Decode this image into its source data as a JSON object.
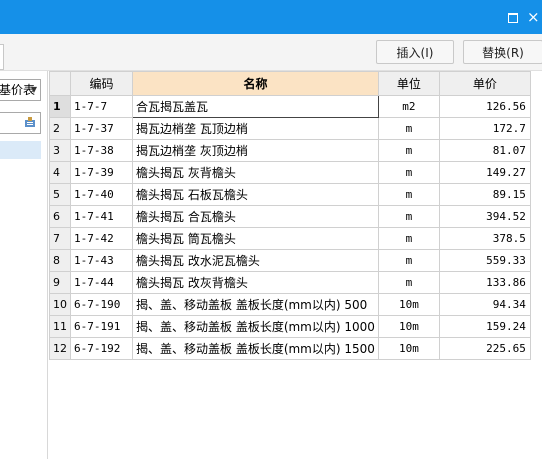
{
  "toolbar": {
    "insert_label": "插入(I)",
    "replace_label": "替换(R)"
  },
  "left": {
    "combo_value": "基价表"
  },
  "columns": {
    "code": "编码",
    "name": "名称",
    "unit": "单位",
    "price": "单价"
  },
  "rows": [
    {
      "num": "1",
      "code": "1-7-7",
      "name": "合瓦揭瓦盖瓦",
      "unit": "m2",
      "price": "126.56"
    },
    {
      "num": "2",
      "code": "1-7-37",
      "name": "揭瓦边梢垄 瓦顶边梢",
      "unit": "m",
      "price": "172.7"
    },
    {
      "num": "3",
      "code": "1-7-38",
      "name": "揭瓦边梢垄 灰顶边梢",
      "unit": "m",
      "price": "81.07"
    },
    {
      "num": "4",
      "code": "1-7-39",
      "name": "檐头揭瓦 灰背檐头",
      "unit": "m",
      "price": "149.27"
    },
    {
      "num": "5",
      "code": "1-7-40",
      "name": "檐头揭瓦 石板瓦檐头",
      "unit": "m",
      "price": "89.15"
    },
    {
      "num": "6",
      "code": "1-7-41",
      "name": "檐头揭瓦 合瓦檐头",
      "unit": "m",
      "price": "394.52"
    },
    {
      "num": "7",
      "code": "1-7-42",
      "name": "檐头揭瓦 筒瓦檐头",
      "unit": "m",
      "price": "378.5"
    },
    {
      "num": "8",
      "code": "1-7-43",
      "name": "檐头揭瓦 改水泥瓦檐头",
      "unit": "m",
      "price": "559.33"
    },
    {
      "num": "9",
      "code": "1-7-44",
      "name": "檐头揭瓦 改灰背檐头",
      "unit": "m",
      "price": "133.86"
    },
    {
      "num": "10",
      "code": "6-7-190",
      "name": "揭、盖、移动盖板 盖板长度(mm以内) 500",
      "unit": "10m",
      "price": "94.34"
    },
    {
      "num": "11",
      "code": "6-7-191",
      "name": "揭、盖、移动盖板 盖板长度(mm以内) 1000",
      "unit": "10m",
      "price": "159.24"
    },
    {
      "num": "12",
      "code": "6-7-192",
      "name": "揭、盖、移动盖板 盖板长度(mm以内) 1500",
      "unit": "10m",
      "price": "225.65"
    }
  ]
}
